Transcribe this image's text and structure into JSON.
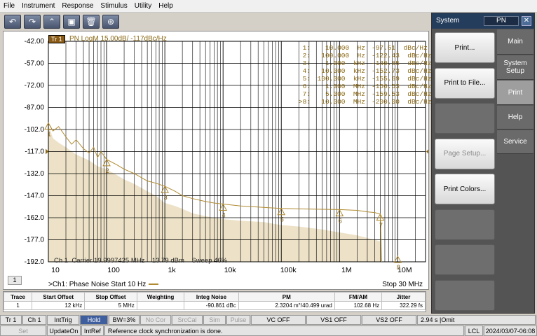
{
  "menubar": [
    "File",
    "Instrument",
    "Response",
    "Stimulus",
    "Utility",
    "Help"
  ],
  "toolbar": {
    "undo_glyph": "↶",
    "redo_glyph": "↷",
    "marker_glyph": "⌃",
    "print_glyph": "▣",
    "delete_glyph": "🗑",
    "zoom_glyph": "⊕",
    "icons": [
      "undo-icon",
      "redo-icon",
      "marker-icon",
      "print-icon",
      "delete-icon",
      "zoom-icon"
    ]
  },
  "trace": {
    "badge": "Tr 1",
    "title": "PN LogM 15.00dB/  -117dBc/Hz"
  },
  "markers": [
    {
      "id": "1:",
      "freq": "10.000  Hz",
      "val": "-97.51  dBc/Hz"
    },
    {
      "id": "2:",
      "freq": "100.000  Hz",
      "val": "-122.43  dBc/Hz"
    },
    {
      "id": "3:",
      "freq": "1.000  kHz",
      "val": "-140.65  dBc/Hz"
    },
    {
      "id": "4:",
      "freq": "10.000  kHz",
      "val": "-152.73  dBc/Hz"
    },
    {
      "id": "5:",
      "freq": "100.000  kHz",
      "val": "-155.69  dBc/Hz"
    },
    {
      "id": "6:",
      "freq": "1.000  MHz",
      "val": "-156.53  dBc/Hz"
    },
    {
      "id": "7:",
      "freq": "5.000  MHz",
      "val": "-159.53  dBc/Hz"
    },
    {
      "id": ">8:",
      "freq": "10.000  MHz",
      "val": "-200.00  dBc/Hz"
    }
  ],
  "carrier_text": "Ch 1  Carrier 19.9997425 MHz    13.79 dBm    Sweep 46%",
  "channel_label": "1",
  "footer": {
    "left": ">Ch1: Phase Noise  Start  10 Hz",
    "right": "Stop  30 MHz"
  },
  "chart_data": {
    "type": "line",
    "x_scale": "log",
    "xlim": [
      10,
      30000000
    ],
    "ylim": [
      -192,
      -42
    ],
    "y_ticks": [
      "-42.00",
      "-57.00",
      "-72.00",
      "-87.00",
      "-102.0",
      "-117.0",
      "-132.0",
      "-147.0",
      "-162.0",
      "-177.0",
      "-192.0"
    ],
    "x_ticks": [
      "10",
      "100",
      "1k",
      "10k",
      "100k",
      "1M",
      "10M"
    ],
    "reference_level": -117,
    "colors": {
      "trace": "#b08a30",
      "fill": "#ede2c8",
      "grid": "#000000"
    },
    "series": [
      {
        "x": [
          10,
          12,
          15,
          20,
          25,
          30,
          40,
          50,
          60,
          70,
          80,
          100,
          150,
          200,
          300,
          500,
          700,
          1000,
          1500,
          2000,
          3000,
          5000,
          7000,
          10000,
          20000,
          50000,
          100000,
          200000,
          500000,
          1000000,
          2000000,
          3000000,
          4000000,
          5000000,
          5300000
        ],
        "y": [
          -97.5,
          -103,
          -100,
          -107,
          -112,
          -109,
          -115,
          -118,
          -114,
          -121,
          -117,
          -122.4,
          -126,
          -129,
          -132,
          -137,
          -138.5,
          -140.6,
          -144,
          -147,
          -149,
          -151,
          -152,
          -152.7,
          -154,
          -155,
          -155.7,
          -156,
          -156.3,
          -156.5,
          -157,
          -158,
          -158.5,
          -159.5,
          -192
        ]
      },
      {
        "x": [
          10,
          12,
          15,
          20,
          30,
          50,
          70,
          100,
          150,
          200,
          300,
          500,
          700,
          1000,
          1500,
          2000,
          3000,
          5000,
          7000,
          10000,
          20000,
          50000,
          100000,
          200000,
          500000,
          1000000,
          2000000,
          4000000,
          5000000,
          5300000
        ],
        "y": [
          -99,
          -108,
          -111,
          -114,
          -119,
          -123,
          -127,
          -129,
          -133,
          -136,
          -139,
          -144,
          -147,
          -152,
          -154,
          -156,
          -159,
          -161,
          -162,
          -163,
          -164,
          -165,
          -167,
          -168,
          -170,
          -172,
          -174,
          -177,
          -178,
          -192
        ]
      }
    ],
    "markers": [
      {
        "n": "1",
        "x": 10,
        "y": -97.51
      },
      {
        "n": "2",
        "x": 100,
        "y": -122.43
      },
      {
        "n": "3",
        "x": 1000,
        "y": -140.65
      },
      {
        "n": "4",
        "x": 10000,
        "y": -152.73
      },
      {
        "n": "5",
        "x": 100000,
        "y": -155.69
      },
      {
        "n": "6",
        "x": 1000000,
        "y": -156.53
      },
      {
        "n": "7",
        "x": 5000000,
        "y": -159.53
      },
      {
        "n": "8",
        "x": 10000000,
        "y": -200
      }
    ]
  },
  "meas_table": {
    "headers": [
      "Trace",
      "Start Offset",
      "Stop Offset",
      "Weighting",
      "Integ Noise",
      "PM",
      "FM/AM",
      "Jitter"
    ],
    "row": [
      "1",
      "12 kHz",
      "5 MHz",
      "",
      "-90.861 dBc",
      "2.3204 m°/40.499 urad",
      "102.68 Hz",
      "322.29 fs"
    ]
  },
  "side": {
    "title": "System",
    "box": "PN",
    "close": "✕",
    "buttons": [
      "Print...",
      "Print to File...",
      "",
      "Page Setup...",
      "Print Colors...",
      "",
      "",
      ""
    ],
    "tabs": [
      "Main",
      "System Setup",
      "Print",
      "Help",
      "Service"
    ]
  },
  "status1": [
    "Tr 1",
    "Ch 1",
    "IntTrig",
    "Hold",
    "BW=3%",
    "No Cor",
    "SrcCal",
    "Sim",
    "Pulse",
    "VC OFF",
    "VS1 OFF",
    "VS2 OFF",
    "2.94 s |Omit"
  ],
  "status2": [
    "Set",
    "UpdateOn",
    "IntRef",
    "Reference clock synchronization is done.",
    "LCL",
    "2024/03/07-06:08"
  ]
}
